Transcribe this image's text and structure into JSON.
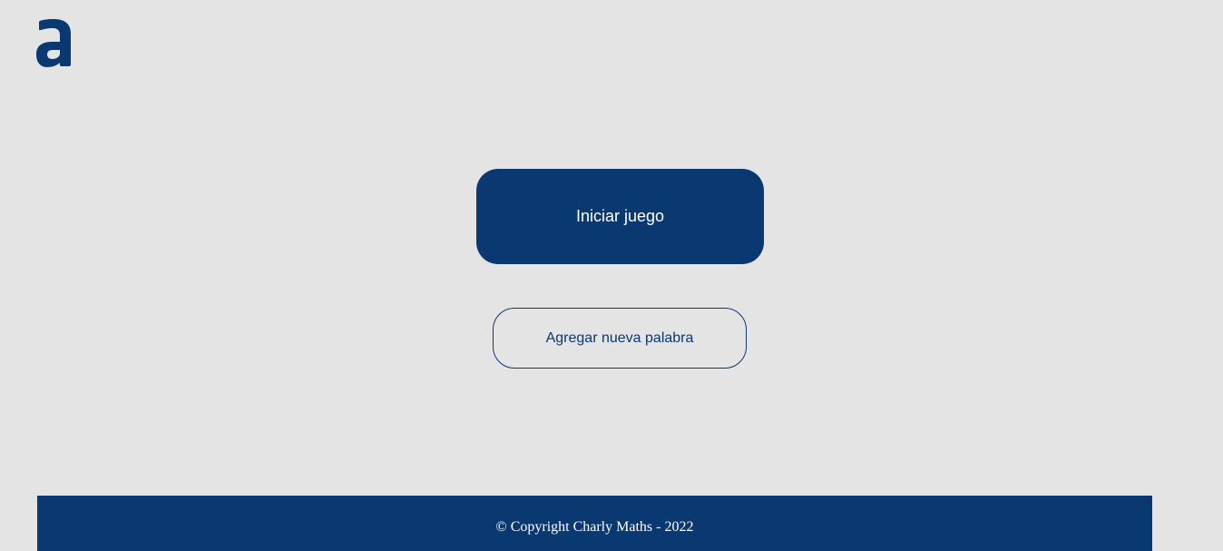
{
  "logo": {
    "icon": "alura-a-logo-icon",
    "color": "#0a3871"
  },
  "actions": {
    "start_label": "Iniciar juego",
    "add_word_label": "Agregar nueva palabra"
  },
  "footer": {
    "copyright": "© Copyright Charly Maths - 2022"
  },
  "colors": {
    "background": "#e4e4e4",
    "primary": "#0a3871",
    "text_on_primary": "#ffffff"
  }
}
